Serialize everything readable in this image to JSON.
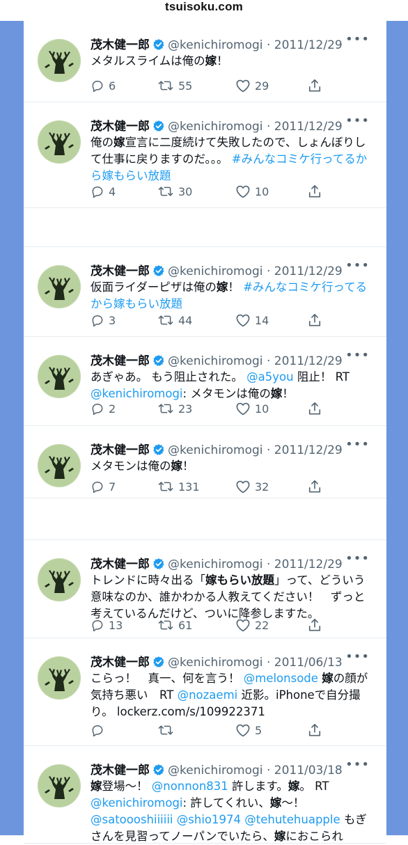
{
  "site": "tsuisoku.com",
  "tweets": [
    {
      "name": "茂木健一郎",
      "handle": "@kenichiromogi",
      "sep": "·",
      "date": "2011/12/29",
      "body": [
        {
          "t": "メタルスライムは俺の"
        },
        {
          "t": "嫁",
          "s": "strong"
        },
        {
          "t": "！"
        }
      ],
      "replies": "6",
      "retweets": "55",
      "likes": "29"
    },
    {
      "name": "茂木健一郎",
      "handle": "@kenichiromogi",
      "sep": "·",
      "date": "2011/12/29",
      "body": [
        {
          "t": "俺の"
        },
        {
          "t": "嫁",
          "s": "strong"
        },
        {
          "t": "宣言に二度続けて失敗したので、しょんぼりして仕事に戻りますのだ。。。 "
        },
        {
          "t": "#みんなコミケ行ってるから嫁もらい放題",
          "s": "link"
        }
      ],
      "replies": "4",
      "retweets": "30",
      "likes": "10"
    },
    {
      "name": "茂木健一郎",
      "handle": "@kenichiromogi",
      "sep": "·",
      "date": "2011/12/29",
      "body": [
        {
          "t": "仮面ライダーピザは俺の"
        },
        {
          "t": "嫁",
          "s": "strong"
        },
        {
          "t": "！ "
        },
        {
          "t": "#みんなコミケ行ってるから嫁もらい放題",
          "s": "link"
        }
      ],
      "replies": "3",
      "retweets": "44",
      "likes": "14"
    },
    {
      "name": "茂木健一郎",
      "handle": "@kenichiromogi",
      "sep": "·",
      "date": "2011/12/29",
      "body": [
        {
          "t": "あぎゃあ。 もう阻止された。 "
        },
        {
          "t": "@a5you",
          "s": "link"
        },
        {
          "t": " 阻止！ RT "
        },
        {
          "t": "@kenichiromogi",
          "s": "link"
        },
        {
          "t": ": メタモンは俺の"
        },
        {
          "t": "嫁",
          "s": "strong"
        },
        {
          "t": "！"
        }
      ],
      "replies": "2",
      "retweets": "23",
      "likes": "10"
    },
    {
      "name": "茂木健一郎",
      "handle": "@kenichiromogi",
      "sep": "·",
      "date": "2011/12/29",
      "body": [
        {
          "t": "メタモンは俺の"
        },
        {
          "t": "嫁",
          "s": "strong"
        },
        {
          "t": "！"
        }
      ],
      "replies": "7",
      "retweets": "131",
      "likes": "32"
    },
    {
      "name": "茂木健一郎",
      "handle": "@kenichiromogi",
      "sep": "·",
      "date": "2011/12/29",
      "body": [
        {
          "t": "トレンドに時々出る「"
        },
        {
          "t": "嫁もらい放題",
          "s": "strong"
        },
        {
          "t": "」って、どういう意味なのか、誰かわかる人教えてください！　ずっと考えているんだけど、ついに降参しますた。"
        }
      ],
      "replies": "13",
      "retweets": "61",
      "likes": "22"
    },
    {
      "name": "茂木健一郎",
      "handle": "@kenichiromogi",
      "sep": "·",
      "date": "2011/06/13",
      "body": [
        {
          "t": "こらっ！　真一、何を言う！ "
        },
        {
          "t": "@melonsode",
          "s": "link"
        },
        {
          "t": " "
        },
        {
          "t": "嫁",
          "s": "strong"
        },
        {
          "t": "の顔が気持ち悪い　RT "
        },
        {
          "t": "@nozaemi",
          "s": "link"
        },
        {
          "t": " 近影。iPhoneで自分撮り。 lockerz.com/s/109922371"
        }
      ],
      "replies": "",
      "retweets": "",
      "likes": "5"
    },
    {
      "name": "茂木健一郎",
      "handle": "@kenichiromogi",
      "sep": "·",
      "date": "2011/03/18",
      "body": [
        {
          "t": "嫁",
          "s": "strong"
        },
        {
          "t": "登場〜！ "
        },
        {
          "t": "@nonnon831",
          "s": "link"
        },
        {
          "t": " 許します。"
        },
        {
          "t": "嫁",
          "s": "strong"
        },
        {
          "t": "。 RT "
        },
        {
          "t": "@kenichiromogi",
          "s": "link"
        },
        {
          "t": ": 許してくれい、"
        },
        {
          "t": "嫁",
          "s": "strong"
        },
        {
          "t": "〜！ "
        },
        {
          "t": "@satoooshiiiiii",
          "s": "link"
        },
        {
          "t": " "
        },
        {
          "t": "@shio1974",
          "s": "link"
        },
        {
          "t": " "
        },
        {
          "t": "@tehutehuapple",
          "s": "link"
        },
        {
          "t": " もぎさんを見習ってノーパンでいたら、"
        },
        {
          "t": "嫁",
          "s": "strong"
        },
        {
          "t": "におこられ"
        }
      ],
      "replies": "",
      "retweets": "",
      "likes": ""
    }
  ]
}
